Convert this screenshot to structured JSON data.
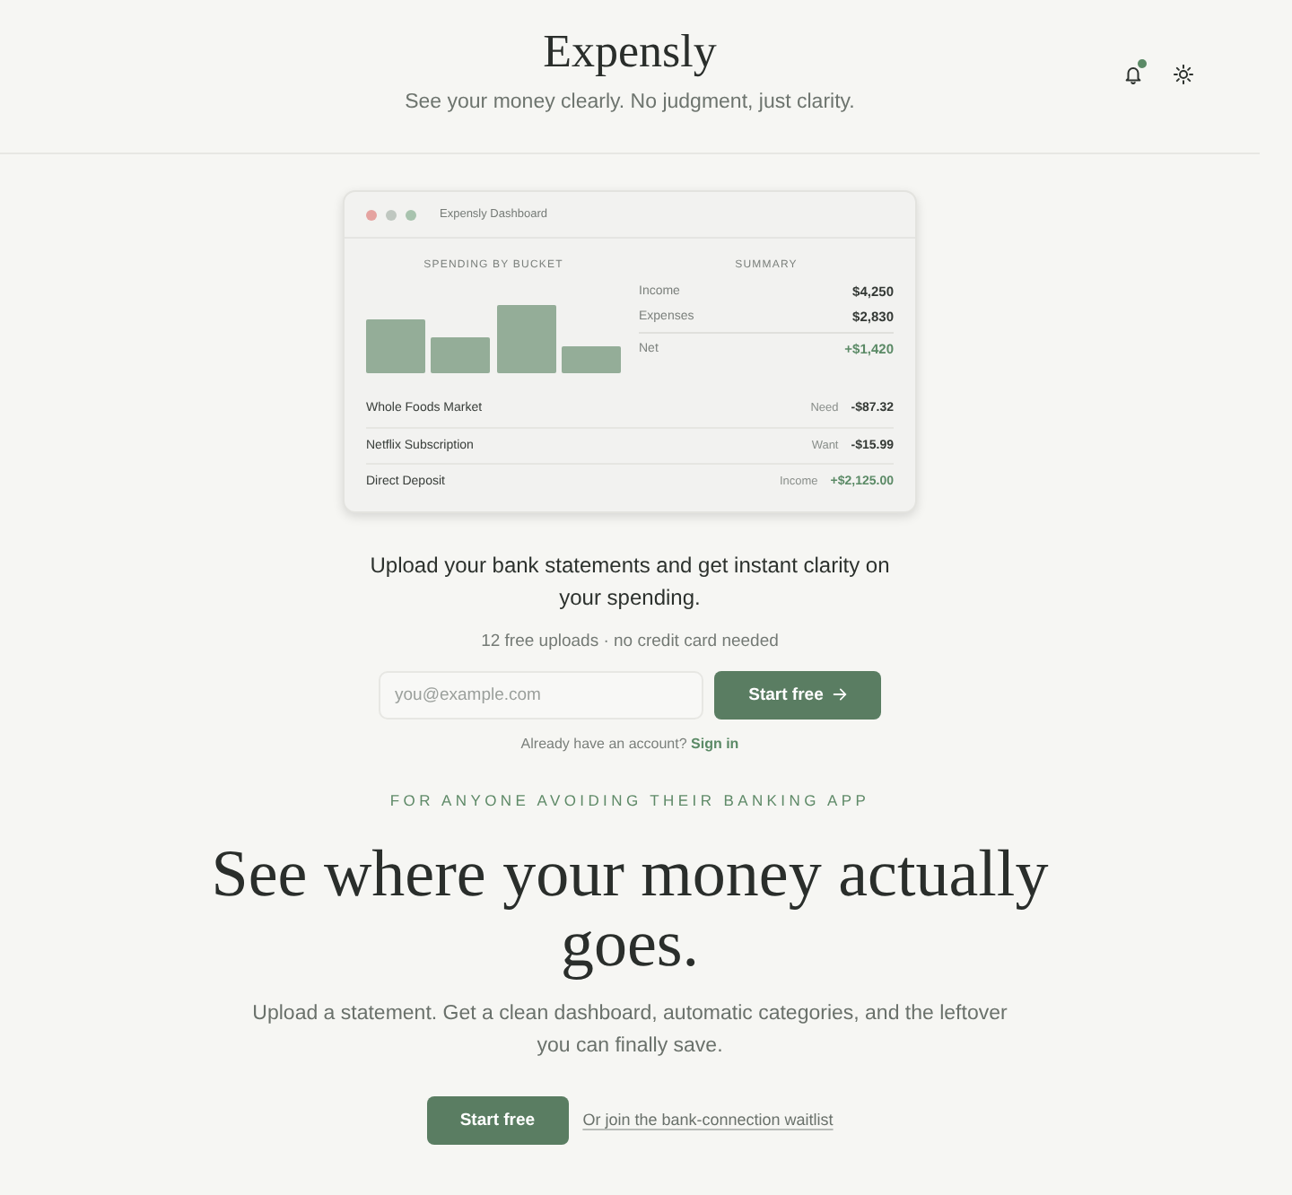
{
  "header": {
    "title": "Expensly",
    "tagline": "See your money clearly. No judgment, just clarity.",
    "notifications": {
      "unread": true
    }
  },
  "dashboard_preview": {
    "window_title": "Expensly Dashboard",
    "spending": {
      "heading": "SPENDING BY BUCKET"
    },
    "summary": {
      "heading": "SUMMARY",
      "rows": [
        {
          "kind": "line",
          "label": "Income",
          "value": "$4,250"
        },
        {
          "kind": "line",
          "label": "Expenses",
          "value": "$2,830"
        },
        {
          "kind": "total",
          "label": "Net",
          "value": "+$1,420"
        }
      ]
    },
    "transactions": [
      {
        "kind": "expense",
        "name": "Whole Foods Market",
        "category": "Need",
        "amount": "-$87.32"
      },
      {
        "kind": "expense",
        "name": "Netflix Subscription",
        "category": "Want",
        "amount": "-$15.99"
      },
      {
        "kind": "income",
        "name": "Direct Deposit",
        "category": "Income",
        "amount": "+$2,125.00"
      }
    ]
  },
  "signup": {
    "headline": "Upload your bank statements and get instant clarity on your spending.",
    "note": "12 free uploads · no credit card needed",
    "email": {
      "placeholder": "you@example.com"
    },
    "button": "Start free",
    "signin_prompt": "Already have an account?",
    "signin_link": "Sign in"
  },
  "hero": {
    "eyebrow": "FOR ANYONE AVOIDING THEIR BANKING APP",
    "heading": "See where your money actually goes.",
    "body": "Upload a statement. Get a clean dashboard, automatic categories, and the leftover you can finally save.",
    "primary_button": "Start free",
    "secondary_link": "Or join the bank-connection waitlist"
  }
}
